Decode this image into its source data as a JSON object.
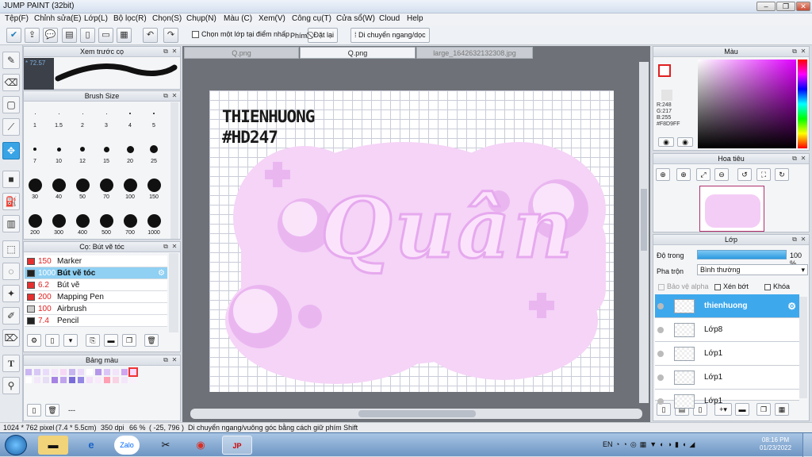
{
  "window": {
    "title": "JUMP PAINT (32bit)"
  },
  "menu": [
    "Tệp(F)",
    "Chỉnh sửa(E)",
    "Lớp(L)",
    "Bộ lọc(R)",
    "Chọn(S)",
    "Chụp(N)",
    "Màu (C)",
    "Xem(V)",
    "Công cụ(T)",
    "Cửa sổ(W)",
    "Cloud",
    "Help"
  ],
  "toolbar": {
    "select_one_layer": "Chọn một lớp tại điểm nhấp",
    "key_label": "Phím",
    "reset": "Đặt lại",
    "move_hv": "Di chuyển ngang/dọc"
  },
  "preview": {
    "title": "Xem trước cọ",
    "value": "* 72.57"
  },
  "brush_size": {
    "title": "Brush Size",
    "sizes": [
      "1",
      "1.5",
      "2",
      "3",
      "4",
      "5",
      "7",
      "10",
      "12",
      "15",
      "20",
      "25",
      "30",
      "40",
      "50",
      "70",
      "100",
      "150",
      "200",
      "300",
      "400",
      "500",
      "700",
      "1000"
    ]
  },
  "brush_panel": {
    "title": "Cọ: Bút vẽ tóc",
    "items": [
      {
        "value": "150",
        "name": "Marker",
        "color": "#e53030"
      },
      {
        "value": "1000",
        "name": "Bút vẽ tóc",
        "color": "#222222"
      },
      {
        "value": "6.2",
        "name": "Bút vẽ",
        "color": "#e53030"
      },
      {
        "value": "200",
        "name": "Mapping Pen",
        "color": "#e53030"
      },
      {
        "value": "100",
        "name": "Airbrush",
        "color": "#cccccc"
      },
      {
        "value": "7.4",
        "name": "Pencil",
        "color": "#222222"
      }
    ]
  },
  "palette": {
    "title": "Bảng màu",
    "footer": "---"
  },
  "tabs": [
    "Q.png",
    "Q.png",
    "large_1642632132308.jpg"
  ],
  "artwork": {
    "line1": "THIENHUONG",
    "line2": "#HD247",
    "word": "Quân"
  },
  "color_panel": {
    "title": "Màu",
    "r": "R:248",
    "g": "G:217",
    "b": "B:255",
    "hex": "#F8D9FF"
  },
  "navigator": {
    "title": "Hoa tiêu"
  },
  "layers": {
    "title": "Lớp",
    "opacity_label": "Độ trong",
    "opacity_value": "100 %",
    "blend_label": "Pha trộn",
    "blend_value": "Bình thường",
    "protect_alpha": "Bảo vệ alpha",
    "clip": "Xén bớt",
    "lock": "Khóa",
    "items": [
      "thienhuong",
      "Lớp8",
      "Lớp1",
      "Lớp1",
      "Lớp1"
    ]
  },
  "status": {
    "size": "1024 * 762 pixel",
    "cm": "(7.4 * 5.5cm)",
    "dpi": "350 dpi",
    "zoom": "66 %",
    "coords": "( -25, 796 )",
    "hint": "Di chuyển ngang/vuông góc bằng cách giữ phím Shift"
  },
  "taskbar": {
    "lang": "EN",
    "time": "08:16 PM",
    "date": "01/23/2022",
    "zalo": "Zalo"
  }
}
